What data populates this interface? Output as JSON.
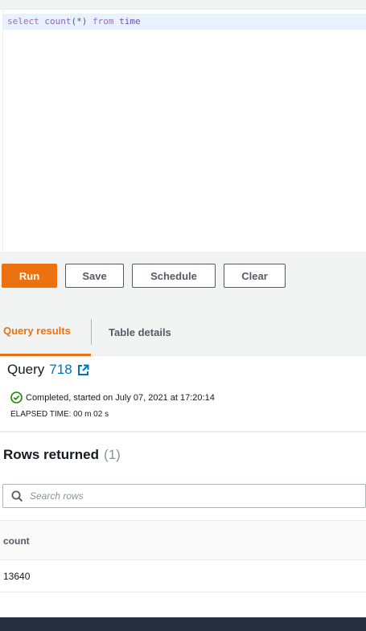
{
  "editor": {
    "keyword_select": "select",
    "function_count": "count",
    "args": "(*)",
    "keyword_from": "from",
    "table_name": "time"
  },
  "toolbar": {
    "run_label": "Run",
    "save_label": "Save",
    "schedule_label": "Schedule",
    "clear_label": "Clear"
  },
  "tabs": {
    "query_results": "Query results",
    "table_details": "Table details"
  },
  "query": {
    "prefix": "Query",
    "number": "718",
    "status": "Completed, started on July 07, 2021 at 17:20:14",
    "elapsed": "ELAPSED TIME: 00 m 02 s"
  },
  "rows": {
    "heading": "Rows returned",
    "count": "(1)"
  },
  "search": {
    "placeholder": "Search rows"
  },
  "table": {
    "columns": [
      "count"
    ],
    "rows": [
      [
        "13640"
      ]
    ]
  },
  "colors": {
    "accent": "#ec7211",
    "link": "#0073bb",
    "success": "#1d8102"
  }
}
